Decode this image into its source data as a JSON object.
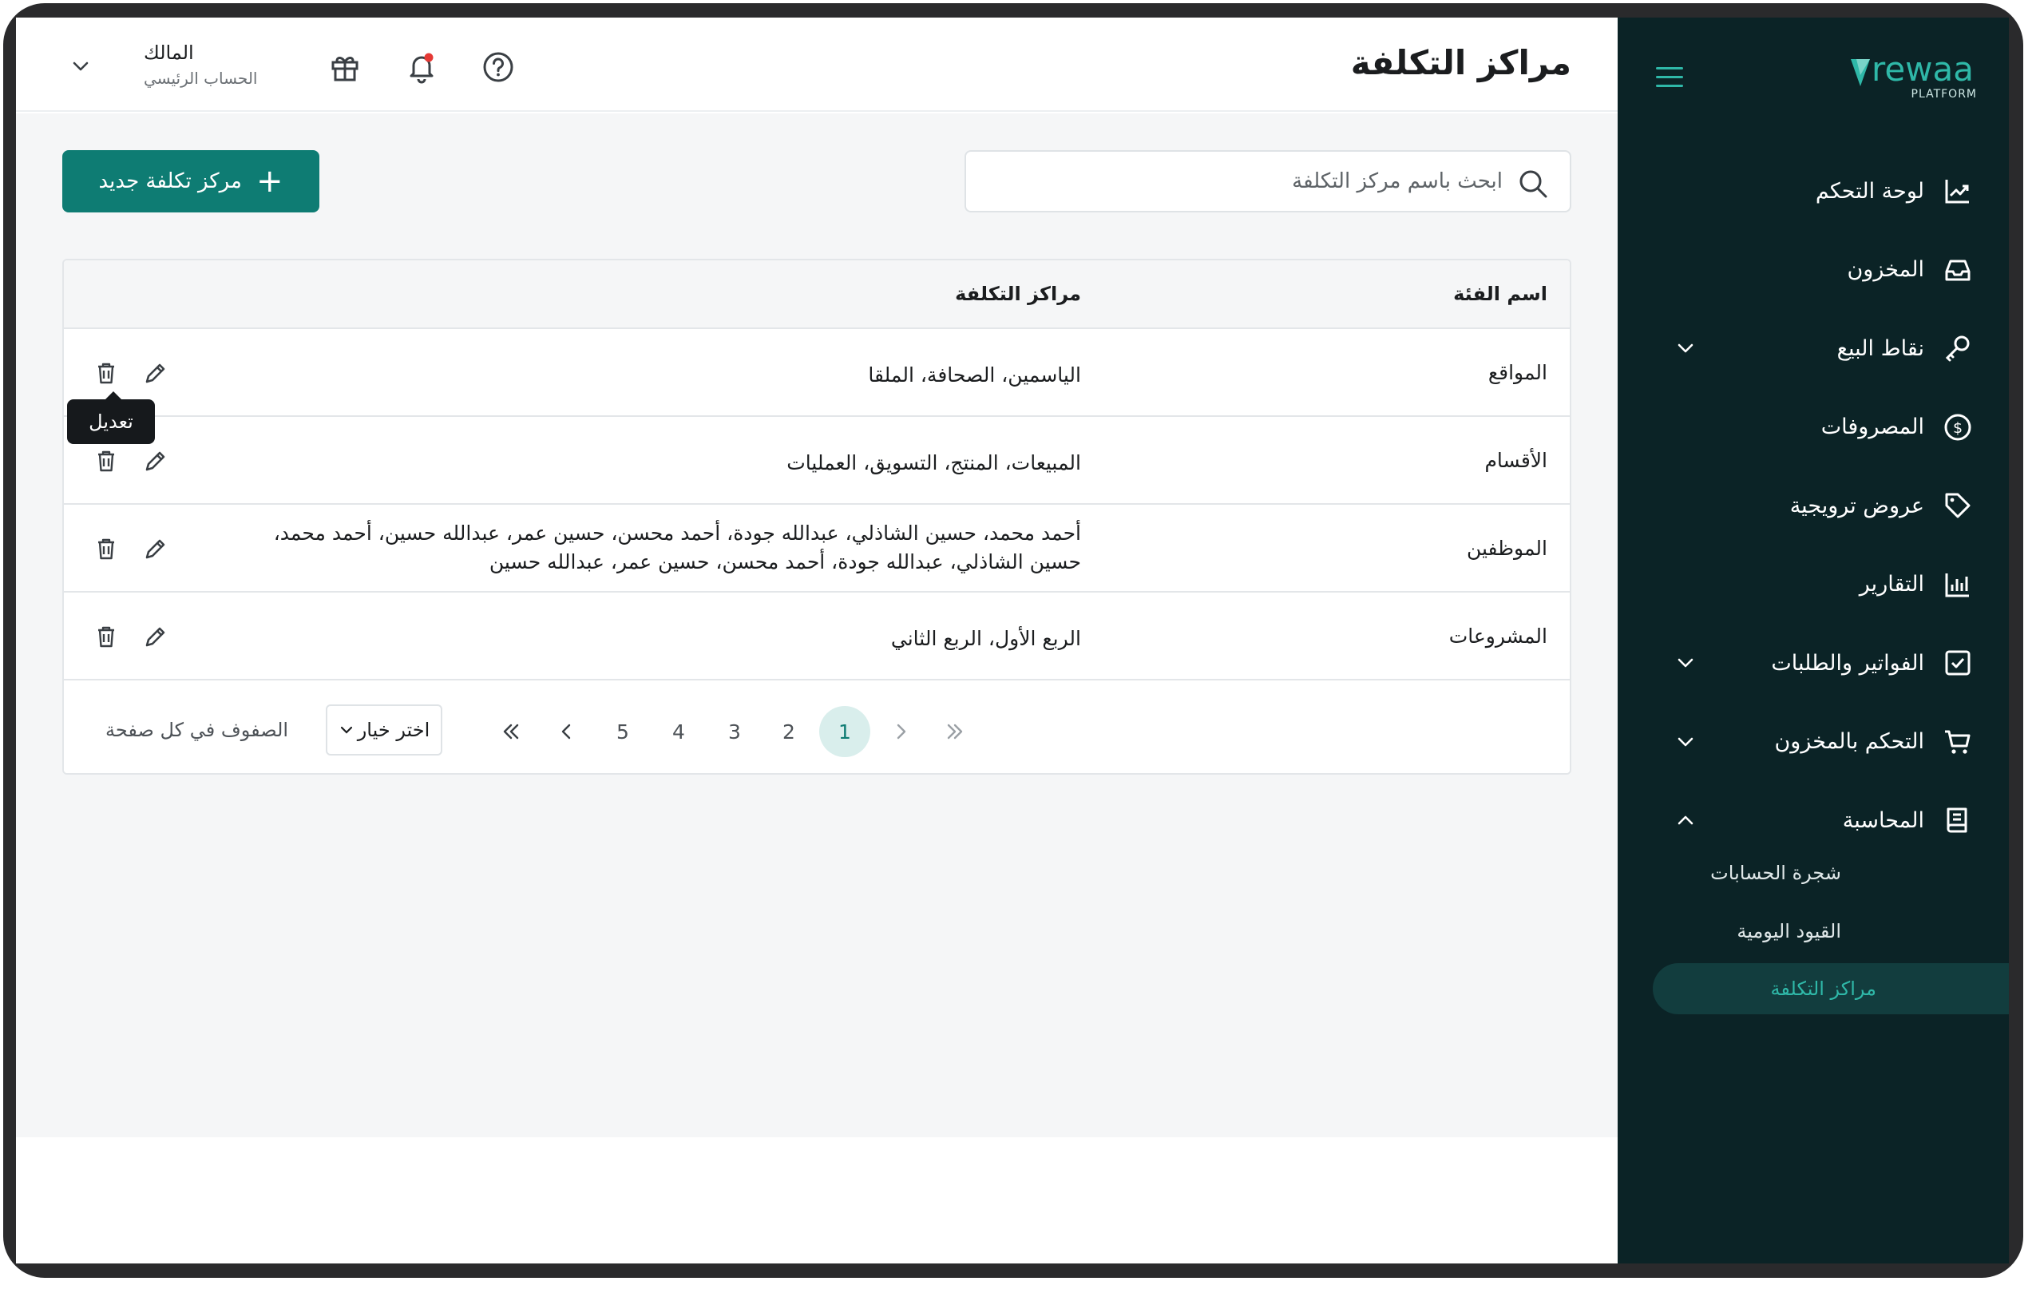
{
  "brand": {
    "name": "rewaa",
    "sub": "PLATFORM",
    "accent": "#2fb8a8",
    "primary": "#0e7c73",
    "sidebar_bg": "#0b2326"
  },
  "sidebar": {
    "items": [
      {
        "label": "لوحة التحكم",
        "icon": "chart-line-icon",
        "expandable": false
      },
      {
        "label": "المخزون",
        "icon": "inbox-tray-icon",
        "expandable": false
      },
      {
        "label": "نقاط البيع",
        "icon": "pos-key-icon",
        "expandable": true,
        "expanded": false
      },
      {
        "label": "المصروفات",
        "icon": "dollar-circle-icon",
        "expandable": false
      },
      {
        "label": "عروض ترويجية",
        "icon": "tag-icon",
        "expandable": false
      },
      {
        "label": "التقارير",
        "icon": "bar-chart-icon",
        "expandable": false
      },
      {
        "label": "الفواتير والطلبات",
        "icon": "check-square-icon",
        "expandable": true,
        "expanded": false
      },
      {
        "label": "التحكم بالمخزون",
        "icon": "cart-icon",
        "expandable": true,
        "expanded": false
      },
      {
        "label": "المحاسبة",
        "icon": "book-icon",
        "expandable": true,
        "expanded": true
      }
    ],
    "sub_items": [
      {
        "label": "شجرة الحسابات",
        "active": false
      },
      {
        "label": "القيود اليومية",
        "active": false
      },
      {
        "label": "مراكز التكلفة",
        "active": true
      }
    ]
  },
  "header": {
    "title": "مراكز التكلفة",
    "user_name": "المالك",
    "user_role": "الحساب الرئيسي"
  },
  "search": {
    "placeholder": "ابحث باسم مركز التكلفة",
    "value": ""
  },
  "new_button": {
    "label": "مركز تكلفة جديد"
  },
  "table": {
    "headers": {
      "category": "اسم الفئة",
      "centers": "مراكز التكلفة"
    },
    "rows": [
      {
        "category": "المواقع",
        "centers": "الياسمين، الصحافة، الملقا"
      },
      {
        "category": "الأقسام",
        "centers": "المبيعات، المنتج، التسويق، العمليات"
      },
      {
        "category": "الموظفين",
        "centers": "أحمد محمد، حسين الشاذلي، عبدالله جودة، أحمد محسن، حسين عمر، عبدالله حسين، أحمد محمد، حسين الشاذلي، عبدالله جودة، أحمد محسن، حسين عمر، عبدالله حسين"
      },
      {
        "category": "المشروعات",
        "centers": "الربع الأول، الربع الثاني"
      }
    ],
    "tooltip": "تعديل"
  },
  "pagination": {
    "rows_per_page_label": "الصفوف في كل صفحة",
    "select_label": "اختر خيار",
    "pages": [
      "1",
      "2",
      "3",
      "4",
      "5"
    ],
    "active_page": "1"
  }
}
